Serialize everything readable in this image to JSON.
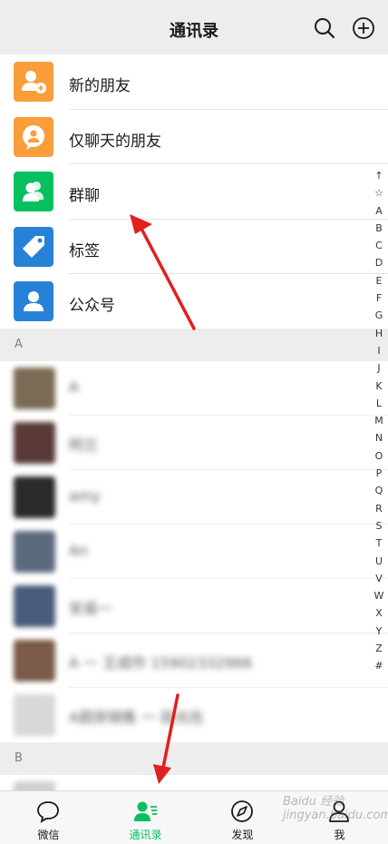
{
  "header": {
    "title": "通讯录"
  },
  "feature_rows": [
    {
      "label": "新的朋友",
      "icon": "add-friend-icon",
      "color": "#fa9d3b"
    },
    {
      "label": "仅聊天的朋友",
      "icon": "chat-only-icon",
      "color": "#fa9d3b"
    },
    {
      "label": "群聊",
      "icon": "group-chat-icon",
      "color": "#07c160"
    },
    {
      "label": "标签",
      "icon": "tag-icon",
      "color": "#2782d7"
    },
    {
      "label": "公众号",
      "icon": "official-account-icon",
      "color": "#2782d7"
    }
  ],
  "sections": [
    {
      "letter": "A"
    },
    {
      "letter": "B"
    }
  ],
  "contacts": [
    {
      "name": "A",
      "photo_color": "#7a6b55"
    },
    {
      "name": "阿兰",
      "photo_color": "#5a3a38"
    },
    {
      "name": "amy",
      "photo_color": "#2a2a2a"
    },
    {
      "name": "An",
      "photo_color": "#5c6a7e"
    },
    {
      "name": "安县一",
      "photo_color": "#4a5a7a"
    },
    {
      "name": "A 一 王成作 15902332966",
      "photo_color": "#7a5a48"
    },
    {
      "name": "A厨房销售 一 段光在",
      "photo_color": "#d8d8d8"
    }
  ],
  "index_letters": [
    "↑",
    "☆",
    "A",
    "B",
    "C",
    "D",
    "E",
    "F",
    "G",
    "H",
    "I",
    "J",
    "K",
    "L",
    "M",
    "N",
    "O",
    "P",
    "Q",
    "R",
    "S",
    "T",
    "U",
    "V",
    "W",
    "X",
    "Y",
    "Z",
    "#"
  ],
  "tabbar": [
    {
      "label": "微信",
      "icon": "chat-bubble-icon",
      "active": false
    },
    {
      "label": "通讯录",
      "icon": "contacts-icon",
      "active": true
    },
    {
      "label": "发现",
      "icon": "compass-icon",
      "active": false
    },
    {
      "label": "我",
      "icon": "me-icon",
      "active": false
    }
  ],
  "colors": {
    "accent": "#07c160",
    "annotation_arrow": "#e02020"
  },
  "watermark": "Baidu 经验 jingyan.baidu.com"
}
